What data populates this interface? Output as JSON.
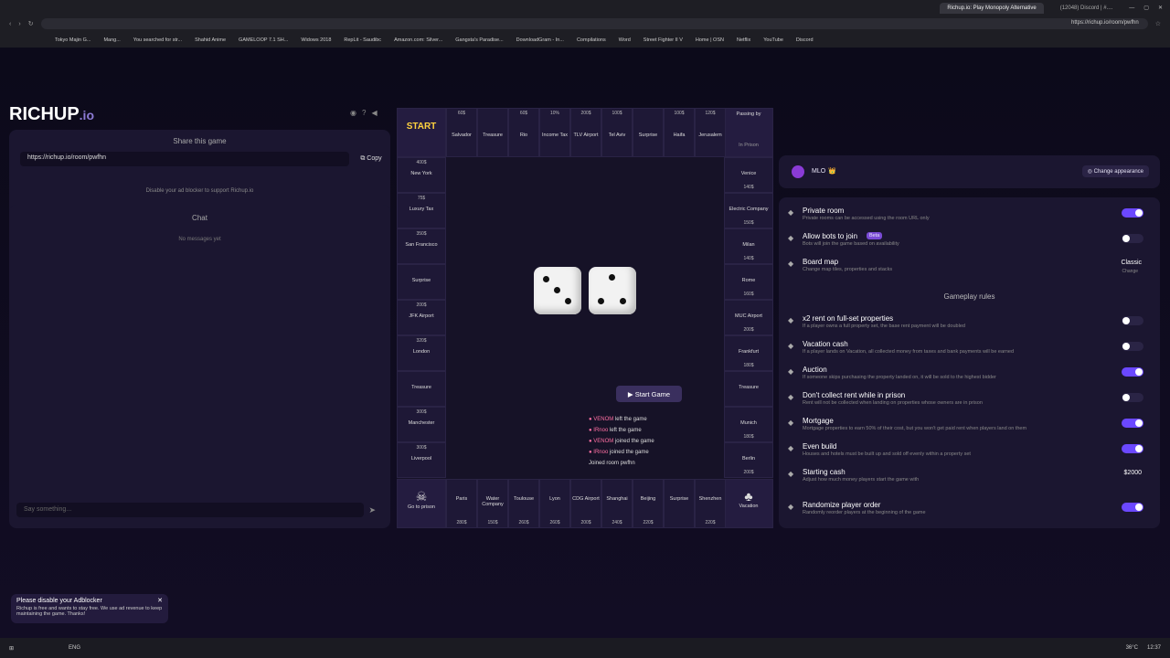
{
  "browser": {
    "tabs": [
      {
        "label": "Richup.io: Play Monopoly Alternative"
      },
      {
        "label": "(12048) Discord | #...."
      }
    ],
    "url": "https://richup.io/room/pwfhn",
    "bookmarks": [
      "Tokyo Majin G...",
      "Mang...",
      "You searched for str...",
      "Shahid Anime",
      "GAMELOOP 7.1 SH...",
      "Widows 2018",
      "RepLit - Saudibc",
      "Amazon.com: Silver...",
      "Gangsta's Paradise...",
      "DownloadGram - In...",
      "Compilations",
      "Word",
      "Street Fighter II V",
      "Home | OSN",
      "Netflix",
      "YouTube",
      "Discord"
    ]
  },
  "left": {
    "logo_main": "RICHUP",
    "logo_suffix": ".io",
    "share_title": "Share this game",
    "room_url": "https://richup.io/room/pwfhn",
    "copy_label": "Copy",
    "adblock_text": "Disable your ad blocker to support Richup.io",
    "chat_title": "Chat",
    "chat_empty": "No messages yet",
    "chat_placeholder": "Say something..."
  },
  "board": {
    "corners": {
      "start": "START",
      "prison": "Go to prison",
      "passing": "Passing by",
      "passing2": "In Prison",
      "vacation": "Vacation"
    },
    "top": [
      {
        "name": "Salvador",
        "price": "60$"
      },
      {
        "name": "Treasure",
        "price": ""
      },
      {
        "name": "Rio",
        "price": "60$"
      },
      {
        "name": "Income Tax",
        "price": "10%"
      },
      {
        "name": "TLV Airport",
        "price": "200$"
      },
      {
        "name": "Tel Aviv",
        "price": "100$"
      },
      {
        "name": "Surprise",
        "price": ""
      },
      {
        "name": "Haifa",
        "price": "100$"
      },
      {
        "name": "Jerusalem",
        "price": "120$"
      }
    ],
    "bottom": [
      {
        "name": "Paris",
        "price": "280$"
      },
      {
        "name": "Water Company",
        "price": "150$"
      },
      {
        "name": "Toulouse",
        "price": "260$"
      },
      {
        "name": "Lyon",
        "price": "260$"
      },
      {
        "name": "CDG Airport",
        "price": "200$"
      },
      {
        "name": "Shanghai",
        "price": "240$"
      },
      {
        "name": "Beijing",
        "price": "220$"
      },
      {
        "name": "Surprise",
        "price": ""
      },
      {
        "name": "Shenzhen",
        "price": "220$"
      }
    ],
    "left": [
      {
        "name": "New York",
        "price": "400$"
      },
      {
        "name": "Luxury Tax",
        "price": "75$"
      },
      {
        "name": "San Francisco",
        "price": "350$"
      },
      {
        "name": "Surprise",
        "price": ""
      },
      {
        "name": "JFK Airport",
        "price": "200$"
      },
      {
        "name": "London",
        "price": "320$"
      },
      {
        "name": "Treasure",
        "price": ""
      },
      {
        "name": "Manchester",
        "price": "300$"
      },
      {
        "name": "Liverpool",
        "price": "300$"
      }
    ],
    "right": [
      {
        "name": "Venice",
        "price": "140$"
      },
      {
        "name": "Electric Company",
        "price": "150$"
      },
      {
        "name": "Milan",
        "price": "140$"
      },
      {
        "name": "Rome",
        "price": "160$"
      },
      {
        "name": "MUC Airport",
        "price": "200$"
      },
      {
        "name": "Frankfurt",
        "price": "180$"
      },
      {
        "name": "Treasure",
        "price": ""
      },
      {
        "name": "Munich",
        "price": "180$"
      },
      {
        "name": "Berlin",
        "price": "200$"
      }
    ],
    "start_button": "Start Game",
    "log": [
      {
        "who": "VENOM",
        "what": "left the game"
      },
      {
        "who": "IRnoo",
        "what": "left the game"
      },
      {
        "who": "VENOM",
        "what": "joined the game"
      },
      {
        "who": "IRnoo",
        "what": "joined the game"
      },
      {
        "who": "",
        "what": "Joined room pwfhn"
      }
    ]
  },
  "right": {
    "player_name": "MLO",
    "player_badge": "👑",
    "change_appearance": "Change appearance",
    "gameplay_title": "Gameplay rules",
    "settings": [
      {
        "title": "Private room",
        "desc": "Private rooms can be accessed using the room URL only",
        "toggle": "on"
      },
      {
        "title": "Allow bots to join",
        "badge": "Beta",
        "desc": "Bots will join the game based on availability",
        "toggle": "off"
      },
      {
        "title": "Board map",
        "desc": "Change map tiles, properties and stacks",
        "value": "Classic",
        "sub": "Change"
      }
    ],
    "rules": [
      {
        "title": "x2 rent on full-set properties",
        "desc": "If a player owns a full property set, the base rent payment will be doubled",
        "toggle": "off"
      },
      {
        "title": "Vacation cash",
        "desc": "If a player lands on Vacation, all collected money from taxes and bank payments will be earned",
        "toggle": "off"
      },
      {
        "title": "Auction",
        "desc": "If someone skips purchasing the property landed on, it will be sold to the highest bidder",
        "toggle": "on"
      },
      {
        "title": "Don't collect rent while in prison",
        "desc": "Rent will not be collected when landing on properties whose owners are in prison",
        "toggle": "off"
      },
      {
        "title": "Mortgage",
        "desc": "Mortgage properties to earn 50% of their cost, but you won't get paid rent when players land on them",
        "toggle": "on"
      },
      {
        "title": "Even build",
        "desc": "Houses and hotels must be built up and sold off evenly within a property set",
        "toggle": "on"
      },
      {
        "title": "Starting cash",
        "desc": "Adjust how much money players start the game with",
        "value": "$2000"
      },
      {
        "title": "Randomize player order",
        "desc": "Randomly reorder players at the beginning of the game",
        "toggle": "on"
      }
    ]
  },
  "toast": {
    "title": "Please disable your Adblocker",
    "body": "Richup is free and wants to stay free. We use ad revenue to keep maintaining the game. Thanks!"
  },
  "taskbar": {
    "lang": "ENG",
    "time": "12:37",
    "weather": "36°C"
  }
}
